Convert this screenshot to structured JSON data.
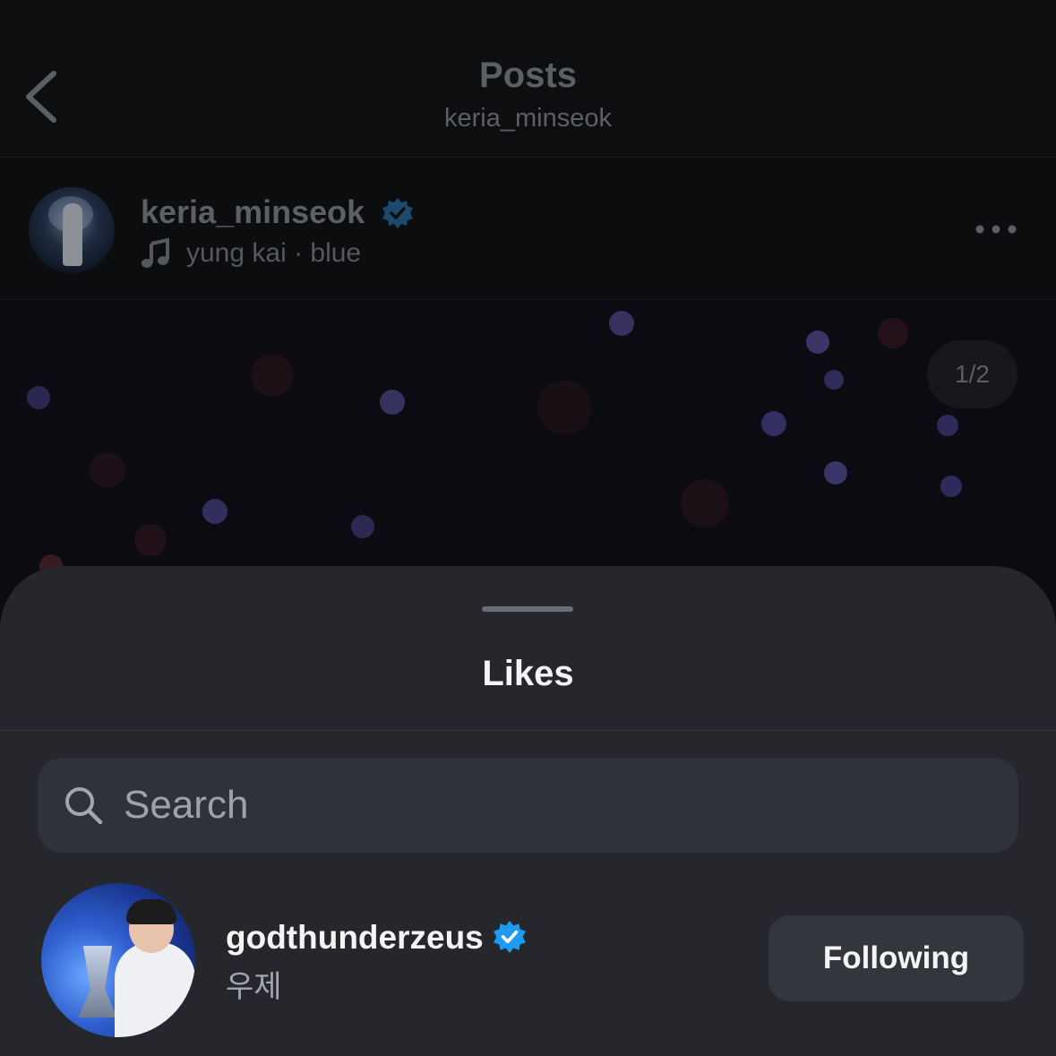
{
  "header": {
    "title": "Posts",
    "subtitle": "keria_minseok"
  },
  "post": {
    "username": "keria_minseok",
    "music": "yung kai · blue",
    "counter": "1/2"
  },
  "likes_sheet": {
    "title": "Likes",
    "search": {
      "placeholder": "Search",
      "value": ""
    },
    "users": [
      {
        "username": "godthunderzeus",
        "name": "우제",
        "verified": true,
        "button_label": "Following"
      }
    ]
  },
  "colors": {
    "verified_badge": "#1d9bf0",
    "sheet_background": "#25272d",
    "button_background": "#33363c"
  }
}
